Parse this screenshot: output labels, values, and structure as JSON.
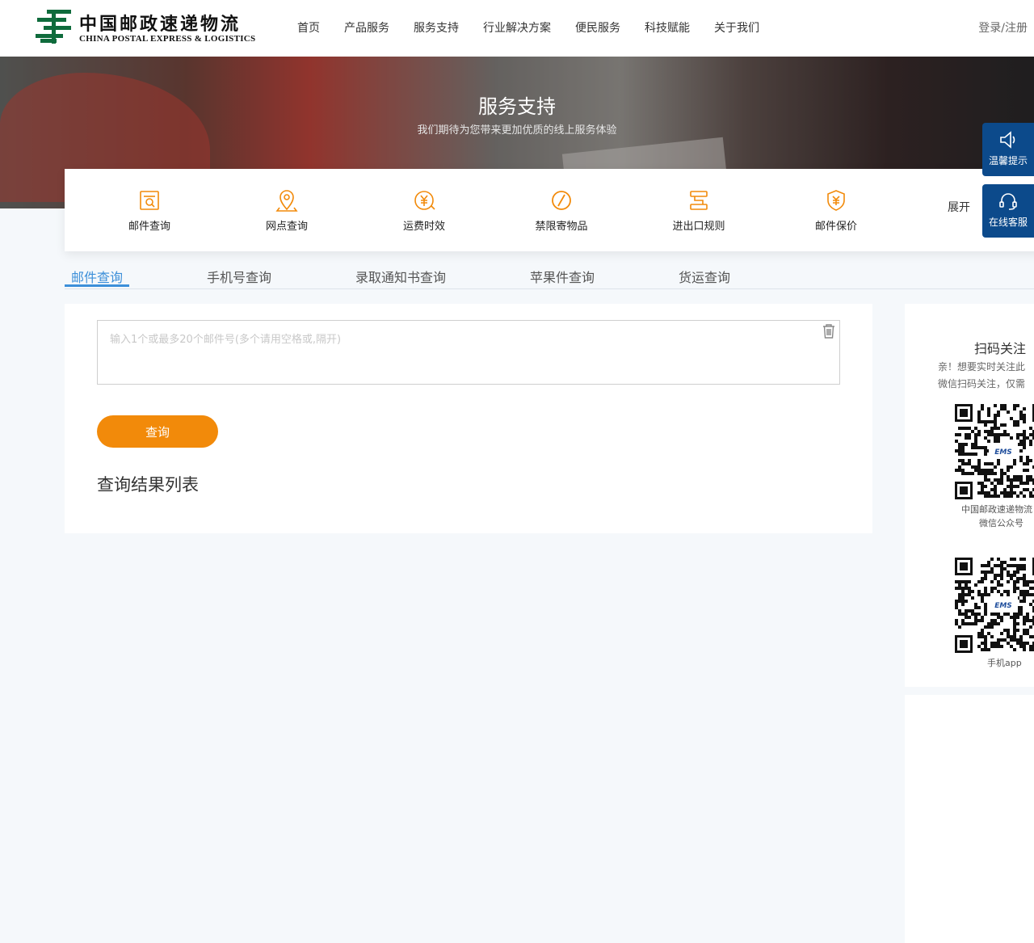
{
  "header": {
    "logo_cn": "中国邮政速递物流",
    "logo_en": "CHINA POSTAL EXPRESS & LOGISTICS",
    "nav": [
      "首页",
      "产品服务",
      "服务支持",
      "行业解决方案",
      "便民服务",
      "科技赋能",
      "关于我们"
    ],
    "login": "登录/注册"
  },
  "banner": {
    "title": "服务支持",
    "subtitle": "我们期待为您带来更加优质的线上服务体验"
  },
  "services": {
    "items": [
      {
        "label": "邮件查询",
        "icon": "mail-search-icon"
      },
      {
        "label": "网点查询",
        "icon": "location-pin-icon"
      },
      {
        "label": "运费时效",
        "icon": "yuan-clock-icon"
      },
      {
        "label": "禁限寄物品",
        "icon": "prohibited-icon"
      },
      {
        "label": "进出口规则",
        "icon": "rules-icon"
      },
      {
        "label": "邮件保价",
        "icon": "shield-yuan-icon"
      }
    ],
    "expand": "展开",
    "accent": "#f28a0a"
  },
  "float": {
    "tips": "温馨提示",
    "service": "在线客服",
    "color": "#0c4a8b"
  },
  "tabs": {
    "items": [
      "邮件查询",
      "手机号查询",
      "录取通知书查询",
      "苹果件查询",
      "货运查询"
    ],
    "active": "邮件查询",
    "accent": "#3c8fd9"
  },
  "query": {
    "placeholder": "输入1个或最多20个邮件号(多个请用空格或,隔开)",
    "value": "",
    "button": "查询",
    "result_title": "查询结果列表"
  },
  "sidebar": {
    "title": "扫码关注",
    "desc_line1": "亲！想要实时关注此",
    "desc_line2": "微信扫码关注，仅需",
    "qr1_caption1": "中国邮政速递物流",
    "qr1_caption2": "微信公众号",
    "qr2_caption": "手机app",
    "qr_logo": "EMS"
  }
}
